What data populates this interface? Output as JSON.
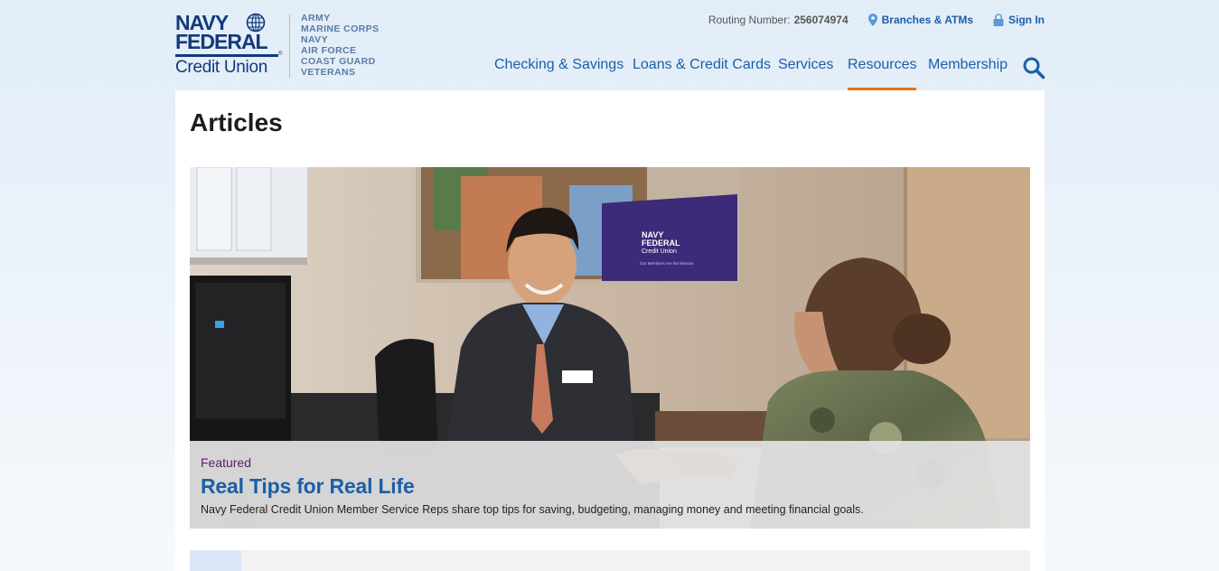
{
  "logo": {
    "line1": "NAVY",
    "line2": "FEDERAL",
    "line3": "Credit Union",
    "registered": "®"
  },
  "branches": [
    "ARMY",
    "MARINE CORPS",
    "NAVY",
    "AIR FORCE",
    "COAST GUARD",
    "VETERANS"
  ],
  "utility": {
    "routing_label": "Routing Number:",
    "routing_number": "256074974",
    "branches_link": "Branches & ATMs",
    "signin_link": "Sign In"
  },
  "nav": {
    "items": [
      "Checking & Savings",
      "Loans & Credit Cards",
      "Services",
      "Resources",
      "Membership"
    ],
    "active": "Resources"
  },
  "page": {
    "title": "Articles"
  },
  "featured": {
    "tag": "Featured",
    "title": "Real Tips for Real Life",
    "description": "Navy Federal Credit Union Member Service Reps share top tips for saving, budgeting, managing money and meeting financial goals.",
    "poster_text": [
      "NAVY",
      "FEDERAL",
      "Credit Union"
    ],
    "poster_tagline": "Our Members Are the Mission"
  },
  "colors": {
    "brand_navy": "#123a7a",
    "link_blue": "#1a5fa8",
    "active_underline": "#e8731a",
    "featured_tag": "#5a1e6b"
  },
  "icons": {
    "location": "map-pin-icon",
    "lock": "lock-icon",
    "search": "search-icon",
    "globe": "globe-icon"
  }
}
